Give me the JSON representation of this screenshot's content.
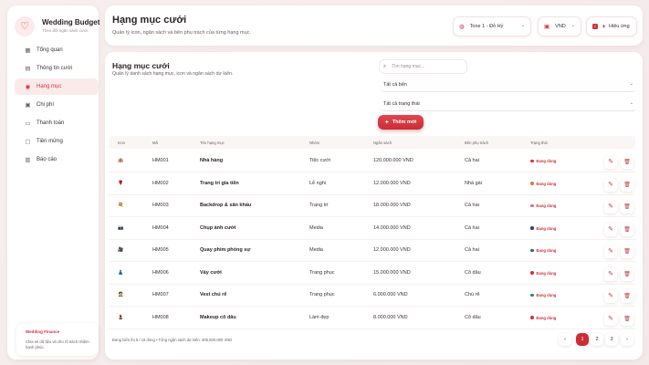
{
  "brand": {
    "title": "Wedding Budget",
    "subtitle": "Theo dõi ngân sách cưới",
    "logo_icon": "♡"
  },
  "nav": [
    {
      "label": "Tổng quan",
      "icon": "▦",
      "active": false
    },
    {
      "label": "Thông tin cưới",
      "icon": "▤",
      "active": false
    },
    {
      "label": "Hạng mục",
      "icon": "◉",
      "active": true
    },
    {
      "label": "Chi phí",
      "icon": "▣",
      "active": false
    },
    {
      "label": "Thanh toán",
      "icon": "▭",
      "active": false
    },
    {
      "label": "Tiền mừng",
      "icon": "▢",
      "active": false
    },
    {
      "label": "Báo cáo",
      "icon": "▥",
      "active": false
    }
  ],
  "side_card": {
    "title": "Wedding Finance",
    "text": "Chia sẻ dữ liệu và cho rõ trách nhiệm hạnh phúc."
  },
  "header": {
    "title": "Hạng mục cưới",
    "subtitle": "Quản lý icon, ngân sách và bên phụ trách của từng hạng mục.",
    "theme_select": "Tone 1 - Đỏ Hỷ",
    "currency_select": "VND",
    "effect_label": "Hiệu ứng"
  },
  "section": {
    "title": "Hạng mục cưới",
    "subtitle": "Quản lý danh sách hạng mục, icon và ngân sách dự kiến.",
    "search_placeholder": "Tìm hạng mục...",
    "filter_side": "Tất cả bên",
    "filter_status": "Tất cả trạng thái",
    "add_label": "Thêm mới"
  },
  "table": {
    "headers": [
      "Icon",
      "Mã",
      "Tên hạng mục",
      "Nhóm",
      "Ngân sách",
      "Bên phụ trách",
      "Trạng thái"
    ],
    "rows": [
      {
        "icon": "🏨",
        "code": "HM001",
        "name": "Nhà hàng",
        "group": "Tiệc cưới",
        "budget": "120.000.000 VND",
        "owner": "Cả hai",
        "status": "Đang dùng",
        "dot": "#d0343c"
      },
      {
        "icon": "🌹",
        "code": "HM002",
        "name": "Trang trí gia tiên",
        "group": "Lễ nghi",
        "budget": "12.000.000 VND",
        "owner": "Nhà gái",
        "status": "Đang dùng",
        "dot": "#e07a3a"
      },
      {
        "icon": "💐",
        "code": "HM003",
        "name": "Backdrop & sân khấu",
        "group": "Trang trí",
        "budget": "18.000.000 VND",
        "owner": "Cả hai",
        "status": "Đang dùng",
        "dot": "#e06a8a"
      },
      {
        "icon": "📷",
        "code": "HM004",
        "name": "Chụp ảnh cưới",
        "group": "Media",
        "budget": "14.000.000 VND",
        "owner": "Cả hai",
        "status": "Đang dùng",
        "dot": "#3a3a7a"
      },
      {
        "icon": "🎥",
        "code": "HM005",
        "name": "Quay phim phóng sự",
        "group": "Media",
        "budget": "12.000.000 VND",
        "owner": "Cả hai",
        "status": "Đang dùng",
        "dot": "#2b6a5a"
      },
      {
        "icon": "👗",
        "code": "HM006",
        "name": "Váy cưới",
        "group": "Trang phục",
        "budget": "15.000.000 VND",
        "owner": "Cô dâu",
        "status": "Đang dùng",
        "dot": "#d0343c"
      },
      {
        "icon": "🤵",
        "code": "HM007",
        "name": "Vest chú rể",
        "group": "Trang phục",
        "budget": "6.000.000 VND",
        "owner": "Chú rể",
        "status": "Đang dùng",
        "dot": "#2f8a5a"
      },
      {
        "icon": "💄",
        "code": "HM008",
        "name": "Makeup cô dâu",
        "group": "Làm đẹp",
        "budget": "8.000.000 VND",
        "owner": "Cô dâu",
        "status": "Đang dùng",
        "dot": "#d0343c"
      }
    ]
  },
  "footer": {
    "summary": "Đang hiển thị 8 / 18 dòng • Tổng ngân sách dự kiến: 305.500.000 VND",
    "pages": [
      "‹",
      "1",
      "2",
      "3",
      "›"
    ],
    "current_page": "1"
  },
  "colors": {
    "accent": "#d0343c",
    "accent_dark": "#c92e36",
    "background": "#f7eeee"
  },
  "icons": {
    "edit": "✎",
    "delete": "🗑",
    "search": "⌕",
    "plus": "+",
    "chevron": "⌄",
    "theme": "◍",
    "currency": "▣",
    "effect": "✦"
  }
}
